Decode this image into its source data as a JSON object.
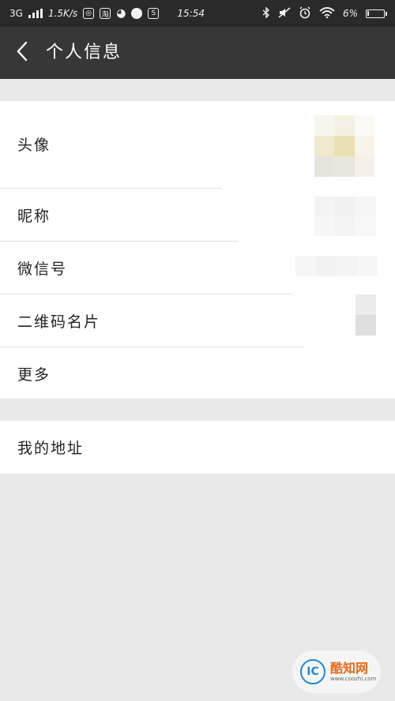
{
  "status_bar": {
    "network": "3G",
    "speed": "1.5K/s",
    "time": "15:54",
    "battery": "6%",
    "app_icons": [
      "netease-icon",
      "taobao-icon",
      "weibo-icon",
      "circle-app-icon",
      "s-app-icon"
    ]
  },
  "header": {
    "title": "个人信息",
    "back_icon": "chevron-left-icon"
  },
  "profile_items": [
    {
      "label": "头像"
    },
    {
      "label": "昵称"
    },
    {
      "label": "微信号"
    },
    {
      "label": "二维码名片"
    },
    {
      "label": "更多"
    }
  ],
  "address_item": {
    "label": "我的地址"
  },
  "colors": {
    "status_bar": "#2a2a2a",
    "title_bar": "#373737",
    "background": "#e9e9e9",
    "row": "#ffffff"
  }
}
